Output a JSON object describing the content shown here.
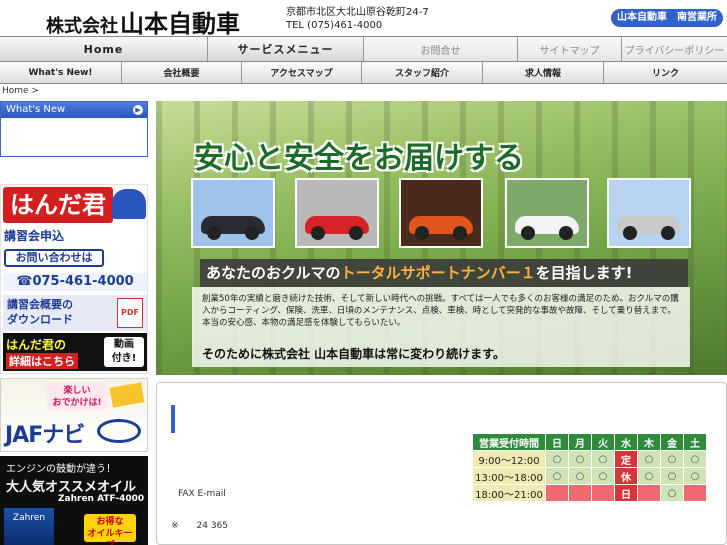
{
  "header": {
    "company_prefix": "株式会社",
    "company_name": "山本自動車",
    "address": "京都市北区大北山原谷乾町24-7",
    "tel": "TEL (075)461-4000",
    "branch_button": "山本自動車　南営業所"
  },
  "nav_main": [
    {
      "label": "Home",
      "state": "active"
    },
    {
      "label": "サービスメニュー",
      "state": "active"
    },
    {
      "label": "お問合せ",
      "state": "muted"
    },
    {
      "label": "サイトマップ",
      "state": "muted"
    },
    {
      "label": "プライバシーポリシー",
      "state": "muted"
    }
  ],
  "nav_sub": [
    {
      "label": "What's New!"
    },
    {
      "label": "会社概要"
    },
    {
      "label": "アクセスマップ"
    },
    {
      "label": "スタッフ紹介"
    },
    {
      "label": "求人情報"
    },
    {
      "label": "リンク"
    }
  ],
  "breadcrumb": "Home >",
  "sidebar": {
    "whats_new": "What's New",
    "banner_handa": {
      "title": "はんだ君",
      "line1": "講習会申込",
      "line2": "お問い合わせは",
      "phone": "☎075-461-4000",
      "download": "講習会概要の\nダウンロード",
      "pdf": "PDF",
      "detail_a": "はんだ君の",
      "detail_b": "詳細はこちら",
      "video": "動画\n付き!"
    },
    "banner_jaf": {
      "bubble": "楽しい\nおでかけは!",
      "logo": "JAFナビ"
    },
    "banner_oil": {
      "line1": "エンジンの鼓動が違う！",
      "line2": "大人気オススメオイル",
      "line3": "Zahren ATF-4000",
      "can": "Zahren",
      "deal": "お得な\nオイルキープ"
    }
  },
  "hero": {
    "slogan": "安心と安全をお届けする",
    "cars": [
      {
        "color": "#2b2b33",
        "bg": "#9fc2e8"
      },
      {
        "color": "#d8222a",
        "bg": "#b9b9b9"
      },
      {
        "color": "#e0561b",
        "bg": "#4a2a1a"
      },
      {
        "color": "#f2f2f2",
        "bg": "#7fa86b"
      },
      {
        "color": "#c9c9c9",
        "bg": "#b7d3ef"
      }
    ],
    "strip_pre": "あなたのおクルマの",
    "strip_hl": "トータルサポートナンバー１",
    "strip_post": "を目指します!",
    "paragraph": "創業50年の実績と磨き続けた技術、そして新しい時代への挑戦。すべては一人でも多くのお客様の満足のため。おクルマの購入からコーティング、保険、洗車、日頃のメンテナンス、点検、車検、時として突発的な事故や故障、そして乗り替えまで。本当の安心感、本物の満足感を体験してもらいたい。",
    "closing": "そのために株式会社 山本自動車は常に変わり続けます。"
  },
  "content": {
    "fax_label": "FAX E-mail",
    "note": "※　　24  365"
  },
  "hours": {
    "headers": [
      "営業受付時間",
      "日",
      "月",
      "火",
      "水",
      "木",
      "金",
      "土"
    ],
    "rows": [
      {
        "time": "9:00〜12:00",
        "cells": [
          "○",
          "○",
          "○",
          "定",
          "○",
          "○",
          "○"
        ]
      },
      {
        "time": "13:00〜18:00",
        "cells": [
          "○",
          "○",
          "○",
          "休",
          "○",
          "○",
          "○"
        ]
      },
      {
        "time": "18:00〜21:00",
        "cells": [
          "",
          "",
          "",
          "日",
          "",
          "○",
          ""
        ]
      }
    ]
  }
}
